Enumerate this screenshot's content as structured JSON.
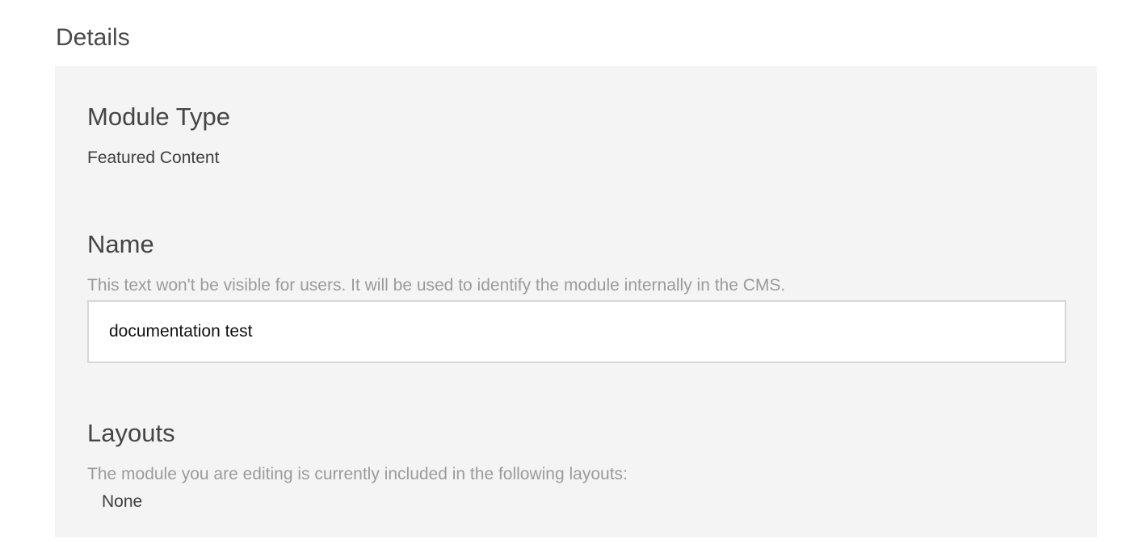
{
  "details": {
    "title": "Details"
  },
  "module_type": {
    "heading": "Module Type",
    "value": "Featured Content"
  },
  "name": {
    "heading": "Name",
    "help": "This text won't be visible for users. It will be used to identify the module internally in the CMS.",
    "value": "documentation test"
  },
  "layouts": {
    "heading": "Layouts",
    "help": "The module you are editing is currently included in the following layouts:",
    "value": "None"
  }
}
